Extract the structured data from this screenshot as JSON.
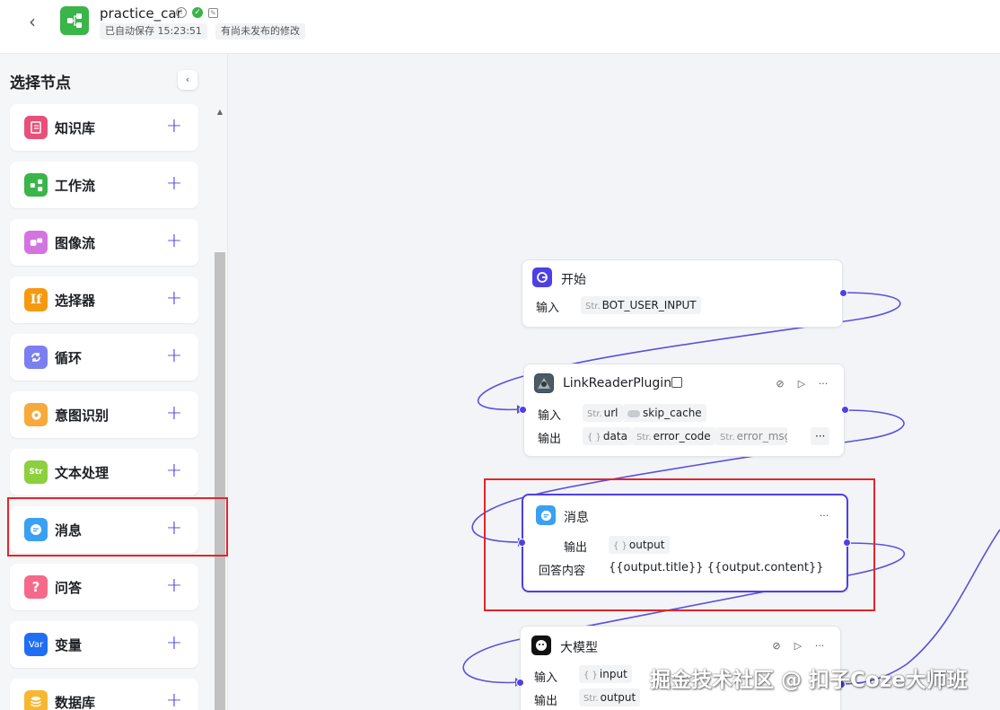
{
  "header": {
    "back_icon": "chevron-left-icon",
    "app_icon": "workflow-icon",
    "title": "practice_car",
    "autosave": "已自动保存 15:23:51",
    "publish_status": "有尚未发布的修改"
  },
  "sidebar": {
    "title": "选择节点",
    "items": [
      {
        "label": "知识库",
        "icon": "knowledge-icon",
        "color": "#e8507a"
      },
      {
        "label": "工作流",
        "icon": "workflow-icon",
        "color": "#39b54a"
      },
      {
        "label": "图像流",
        "icon": "imageflow-icon",
        "color": "#d474e0"
      },
      {
        "label": "选择器",
        "icon": "if-icon",
        "glyph": "If",
        "color": "#f59a0f"
      },
      {
        "label": "循环",
        "icon": "loop-icon",
        "color": "#7b7ff0"
      },
      {
        "label": "意图识别",
        "icon": "intent-icon",
        "color": "#f7a93a"
      },
      {
        "label": "文本处理",
        "icon": "text-process-icon",
        "glyph": "Str",
        "color": "#8ccf3f"
      },
      {
        "label": "消息",
        "icon": "message-icon",
        "color": "#3aa0f3"
      },
      {
        "label": "问答",
        "icon": "qa-icon",
        "glyph": "?",
        "color": "#f56a8a"
      },
      {
        "label": "变量",
        "icon": "variable-icon",
        "glyph": "Var",
        "color": "#1f6ef5"
      },
      {
        "label": "数据库",
        "icon": "database-icon",
        "color": "#f7b731"
      }
    ]
  },
  "nodes": {
    "start": {
      "title": "开始",
      "input_label": "输入",
      "input_tag": {
        "type": "Str.",
        "name": "BOT_USER_INPUT"
      }
    },
    "link_reader": {
      "title": "LinkReaderPlugin",
      "input_label": "输入",
      "output_label": "输出",
      "inputs": [
        {
          "type": "Str.",
          "name": "url"
        },
        {
          "type": "toggle",
          "name": "skip_cache"
        }
      ],
      "outputs": [
        {
          "type": "{ }",
          "name": "data"
        },
        {
          "type": "Str.",
          "name": "error_code"
        },
        {
          "type": "Str.",
          "name": "error_msg"
        }
      ],
      "more": "···"
    },
    "message": {
      "title": "消息",
      "output_label": "输出",
      "output_tag": {
        "type": "{ }",
        "name": "output"
      },
      "answer_label": "回答内容",
      "answer_value": "{{output.title}} {{output.content}}",
      "more": "···"
    },
    "llm": {
      "title": "大模型",
      "input_label": "输入",
      "output_label": "输出",
      "input_tag": {
        "type": "{ }",
        "name": "input"
      },
      "output_tag": {
        "type": "Str.",
        "name": "output"
      }
    }
  },
  "watermark": "掘金技术社区 @ 扣子Coze大师班",
  "colors": {
    "accent": "#4e40e5",
    "highlight": "#e5242a",
    "edge": "#5a50dd"
  }
}
